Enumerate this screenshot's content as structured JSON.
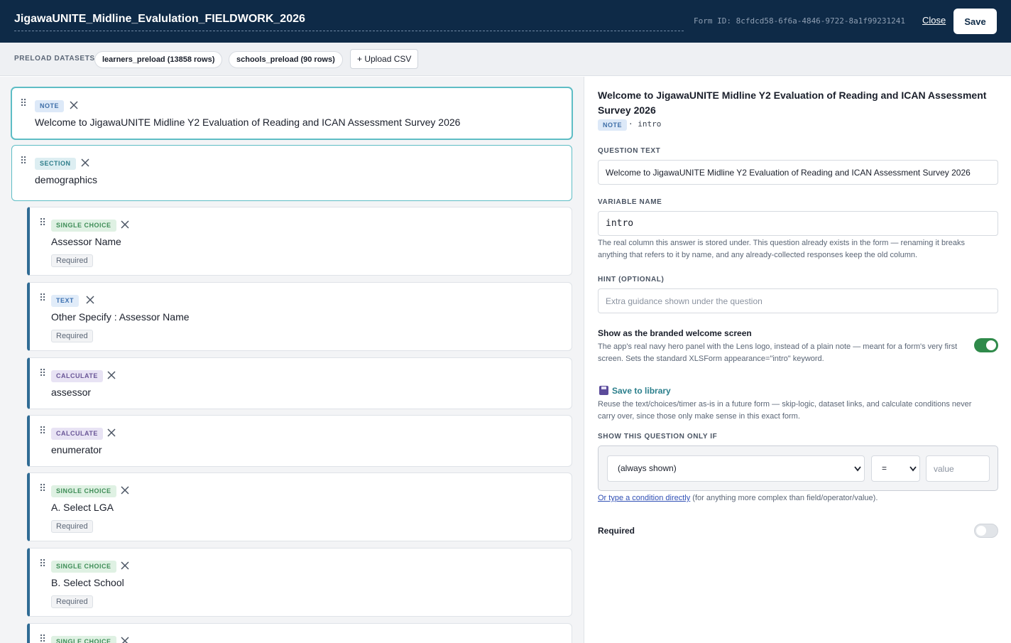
{
  "header": {
    "form_title": "JigawaUNITE_Midline_Evalulation_FIELDWORK_2026",
    "form_id": "Form ID: 8cfdcd58-6f6a-4846-9722-8a1f99231241",
    "close_label": "Close",
    "save_label": "Save"
  },
  "datasets": {
    "label": "PRELOAD DATASETS",
    "chips": [
      "learners_preload (13858 rows)",
      "schools_preload (90 rows)"
    ],
    "upload_label": "+ Upload CSV"
  },
  "questions": [
    {
      "type": "NOTE",
      "label": "Welcome to JigawaUNITE Midline Y2 Evaluation of Reading and ICAN Assessment Survey 2026"
    },
    {
      "type": "SECTION",
      "label": "demographics"
    },
    {
      "type": "SINGLE CHOICE",
      "label": "Assessor Name",
      "required": "Required"
    },
    {
      "type": "TEXT",
      "label": "Other Specify : Assessor Name",
      "required": "Required"
    },
    {
      "type": "CALCULATE",
      "label": "assessor"
    },
    {
      "type": "CALCULATE",
      "label": "enumerator"
    },
    {
      "type": "SINGLE CHOICE",
      "label": "A. Select LGA",
      "required": "Required"
    },
    {
      "type": "SINGLE CHOICE",
      "label": "B. Select School",
      "required": "Required"
    },
    {
      "type": "SINGLE CHOICE"
    }
  ],
  "drag_glyph": "⠿",
  "editor": {
    "title": "Welcome to JigawaUNITE Midline Y2 Evaluation of Reading and ICAN Assessment Survey 2026",
    "badge": "NOTE",
    "variable_display": "· intro",
    "question_text_label": "QUESTION TEXT",
    "question_text_value": "Welcome to JigawaUNITE Midline Y2 Evaluation of Reading and ICAN Assessment Survey 2026",
    "variable_name_label": "VARIABLE NAME",
    "variable_name_value": "intro",
    "variable_help": "The real column this answer is stored under. This question already exists in the form — renaming it breaks anything that refers to it by name, and any already-collected responses keep the old column.",
    "hint_label": "HINT (OPTIONAL)",
    "hint_placeholder": "Extra guidance shown under the question",
    "welcome_title": "Show as the branded welcome screen",
    "welcome_help": "The app's real navy hero panel with the Lens logo, instead of a plain note — meant for a form's very first screen. Sets the standard XLSForm appearance=\"intro\" keyword.",
    "welcome_on": true,
    "library_label": "Save to library",
    "library_help": "Reuse the text/choices/timer as-is in a future form — skip-logic, dataset links, and calculate conditions never carry over, since those only make sense in this exact form.",
    "condition_label": "SHOW THIS QUESTION ONLY IF",
    "condition_field": "(always shown)",
    "condition_operator": "=",
    "condition_value_placeholder": "value",
    "condition_link": "Or type a condition directly",
    "condition_note": "(for anything more complex than field/operator/value).",
    "required_label": "Required",
    "required_on": false
  },
  "colors": {
    "header_bg": "#0e2a47",
    "accent_teal": "#5ebdc5",
    "toggle_on": "#2f8a4a"
  }
}
